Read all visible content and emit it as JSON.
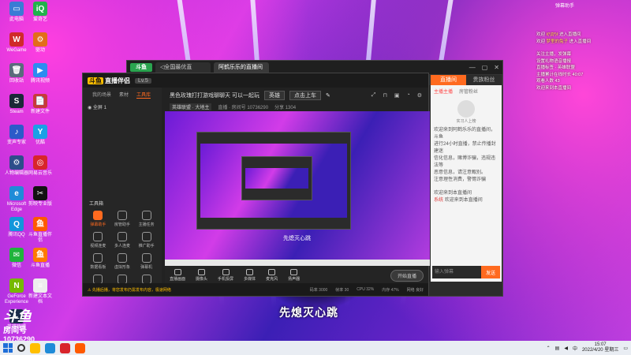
{
  "desktop": {
    "icons_left": [
      {
        "label": "此电脑",
        "glyph": "▭",
        "color": "#3a7bd5"
      },
      {
        "label": "爱奇艺",
        "glyph": "iQ",
        "color": "#22b14c"
      },
      {
        "label": "WeGame",
        "glyph": "W",
        "color": "#d02a2a"
      },
      {
        "label": "驱动",
        "glyph": "⚙",
        "color": "#e36d1a"
      },
      {
        "label": "回收站",
        "glyph": "🗑",
        "color": "#5a6b7c"
      },
      {
        "label": "腾讯视频",
        "glyph": "▶",
        "color": "#2d8cf0"
      },
      {
        "label": "Steam",
        "glyph": "S",
        "color": "#1b2838"
      },
      {
        "label": "新建文件",
        "glyph": "📄",
        "color": "#c73b3b"
      },
      {
        "label": "变声专家",
        "glyph": "♪",
        "color": "#2c5ac9"
      },
      {
        "label": "优酷",
        "glyph": "Y",
        "color": "#1aa0e6"
      },
      {
        "label": "人物编辑器",
        "glyph": "⚙",
        "color": "#2d4d8a"
      },
      {
        "label": "网易云音乐",
        "glyph": "◎",
        "color": "#d8252b"
      },
      {
        "label": "Microsoft Edge",
        "glyph": "e",
        "color": "#1f8bd8"
      },
      {
        "label": "剪映专业版",
        "glyph": "✂",
        "color": "#111111"
      },
      {
        "label": "腾讯QQ",
        "glyph": "Q",
        "color": "#1296db"
      },
      {
        "label": "斗鱼直播伴侣",
        "glyph": "鱼",
        "color": "#ff5a00"
      },
      {
        "label": "微信",
        "glyph": "✉",
        "color": "#20b33c"
      },
      {
        "label": "斗鱼直播",
        "glyph": "鱼",
        "color": "#ff7a00"
      },
      {
        "label": "GeForce Experience",
        "glyph": "N",
        "color": "#76b900"
      },
      {
        "label": "新建文本文档",
        "glyph": "≡",
        "color": "#eeeeee"
      },
      {
        "label": "英雄联盟",
        "glyph": "L",
        "color": "#1a2a4a"
      }
    ]
  },
  "browser": {
    "logo": "斗鱼",
    "tab1": "◁全国最优直",
    "tab2": "阿鹤乐乐的直播间",
    "window_controls": [
      "—",
      "▢",
      "✕"
    ]
  },
  "chat_panel": {
    "tab_chat": "直播间",
    "tab_fans": "贵族粉丝",
    "sub_tabs": [
      "主播主播",
      "房管粉丝"
    ],
    "anchor_label": "实习人上榜",
    "messages": [
      "欢迎来到阿鹤乐乐的直播间，斗鱼",
      "进行24小时直播，禁止传播封建迷",
      "信化信息，赌博诈骗，违规违法等",
      "恶意信息，请注意甄别。",
      "注意理性消费，警惕诈骗"
    ],
    "welcome_1": "欢迎来到本直播间",
    "welcome_2_prefix": "系统",
    "welcome_2": "欢迎来到本直播间",
    "input_placeholder": "输入弹幕",
    "send_label": "发送"
  },
  "app": {
    "brand": "直播伴侣",
    "brand_badge": "斗鱼",
    "level": "Lv.5",
    "side_tabs": [
      "我的场景",
      "素材",
      "工具库"
    ],
    "scene_label": "全屏 1",
    "room_title": "黑色玫瑰打打游戏聊聊天 可以一起玩",
    "category": "英雄",
    "room_meta": [
      "英雄联盟 · 大地主",
      "直播 · 房间号 10736290",
      "分享 1304"
    ],
    "start_btn": "点击上车",
    "tools_title": "工具箱",
    "tools": [
      {
        "label": "弹幕助手",
        "hot": true
      },
      {
        "label": "房管助手",
        "hot": false
      },
      {
        "label": "主播任务",
        "hot": false
      },
      {
        "label": "视频连麦",
        "hot": false
      },
      {
        "label": "多人连麦",
        "hot": false
      },
      {
        "label": "推广助手",
        "hot": false
      },
      {
        "label": "数据看板",
        "hot": false
      },
      {
        "label": "虚拟形象",
        "hot": false
      },
      {
        "label": "弹幕机",
        "hot": false
      },
      {
        "label": "PK玩法",
        "hot": false
      },
      {
        "label": "更多",
        "hot": false
      },
      {
        "label": "设置",
        "hot": false
      }
    ],
    "bottom_tools": [
      "直播画面",
      "摄像头",
      "手机投屏",
      "多媒体",
      "麦克风",
      "扬声器"
    ],
    "go_live": "开始直播",
    "status_warn": "⚠ 先播后播，将您发布仍需发布内容，极速网络",
    "status_stats": [
      "码率 3000",
      "帧率 30",
      "CPU 32%",
      "内存 47%",
      "网络 良好"
    ],
    "preview_caption": "先熄灭心跳"
  },
  "subtitle": "先熄灭心跳",
  "watermark": {
    "logo": "斗鱼",
    "room_label": "房间号",
    "room_number": "10736290"
  },
  "overlay": {
    "title": "弹幕助手",
    "lines": [
      {
        "t": "欢迎 ",
        "h": "ℓ(ºДº)ℓ",
        "r": " 进入直播间"
      },
      {
        "t": "欢迎 ",
        "h": "梦里的兔子",
        "r": " 进入直播间"
      },
      {
        "t": "",
        "h": "",
        "r": ""
      },
      {
        "t": "关注主播，发弹幕",
        "h": "",
        "r": ""
      },
      {
        "t": "设置礼物语音播报",
        "h": "",
        "r": ""
      },
      {
        "t": "直播标签 · 英雄联盟",
        "h": "",
        "r": ""
      },
      {
        "t": "主播累计在线时长 40:07",
        "h": "",
        "r": ""
      },
      {
        "t": "观看人数 43",
        "h": "",
        "r": ""
      },
      {
        "t": "欢迎来到本直播间",
        "h": "",
        "r": ""
      }
    ]
  },
  "taskbar": {
    "time": "15:07",
    "date": "2022/4/20 星期三",
    "lang": "中"
  }
}
